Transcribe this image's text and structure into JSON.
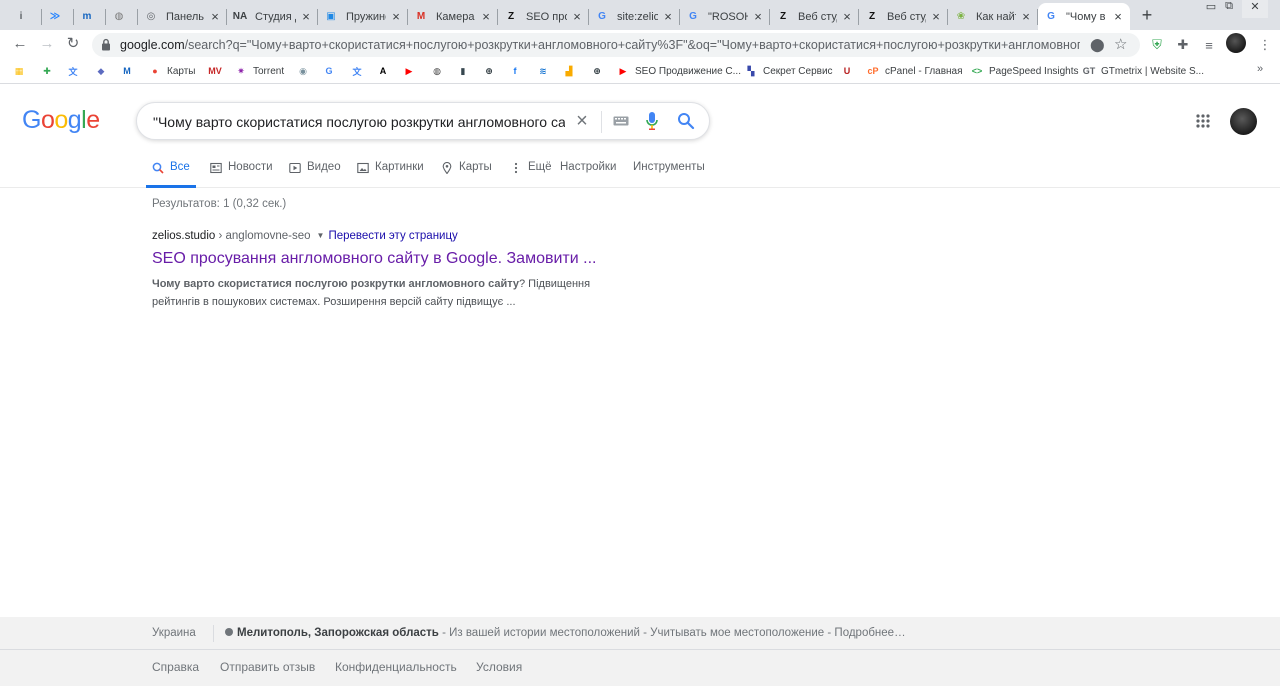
{
  "browser": {
    "tabs": [
      {
        "title": "",
        "icon": "info-icon",
        "favicon_text": "i",
        "favicon_color": "#5f6368"
      },
      {
        "title": "",
        "icon": "jira-icon",
        "favicon_text": "≫",
        "favicon_color": "#2684ff"
      },
      {
        "title": "",
        "icon": "m-icon",
        "favicon_text": "m",
        "favicon_color": "#1565c0"
      },
      {
        "title": "",
        "icon": "globe-icon",
        "favicon_text": "◍",
        "favicon_color": "#777777"
      },
      {
        "title": "Панель с",
        "icon": "globe-icon",
        "favicon_text": "◎",
        "favicon_color": "#5f6368"
      },
      {
        "title": "Студия д",
        "icon": "na-icon",
        "favicon_text": "NA",
        "favicon_color": "#3c4043"
      },
      {
        "title": "Пружине",
        "icon": "image-icon",
        "favicon_text": "▣",
        "favicon_color": "#1e88e5"
      },
      {
        "title": "Камера з",
        "icon": "gmail-icon",
        "favicon_text": "M",
        "favicon_color": "#d93025"
      },
      {
        "title": "SEO про",
        "icon": "zelios-icon",
        "favicon_text": "Z",
        "favicon_color": "#111111"
      },
      {
        "title": "site:zelio",
        "icon": "google-icon",
        "favicon_text": "G",
        "favicon_color": "#4285f4"
      },
      {
        "title": "\"ROSOH",
        "icon": "google-icon",
        "favicon_text": "G",
        "favicon_color": "#4285f4"
      },
      {
        "title": "Веб студ",
        "icon": "zelios-icon",
        "favicon_text": "Z",
        "favicon_color": "#111111"
      },
      {
        "title": "Веб студ",
        "icon": "zelios-icon",
        "favicon_text": "Z",
        "favicon_color": "#111111"
      },
      {
        "title": "Как найт",
        "icon": "leaf-icon",
        "favicon_text": "❀",
        "favicon_color": "#7cb342"
      },
      {
        "title": "\"Чому в",
        "icon": "google-icon",
        "favicon_text": "G",
        "favicon_color": "#4285f4",
        "active": true
      }
    ],
    "close_glyph": "×",
    "new_tab_glyph": "+",
    "url_host": "google.com",
    "url_rest": "/search?q=\"Чому+варто+скористатися+послугою+розкрутки+англомовного+сайту%3F\"&oq=\"Чому+варто+скористатися+послугою+розкрутки+англомовного+са...",
    "bookmarks": [
      {
        "label": "",
        "icon": "sheets-icon",
        "icon_text": "▦",
        "color": "#fbbc04"
      },
      {
        "label": "",
        "icon": "plus-icon",
        "icon_text": "✚",
        "color": "#34a853"
      },
      {
        "label": "",
        "icon": "translate-icon",
        "icon_text": "文",
        "color": "#4285f4"
      },
      {
        "label": "",
        "icon": "drop-icon",
        "icon_text": "◆",
        "color": "#5c6bc0"
      },
      {
        "label": "",
        "icon": "m-icon",
        "icon_text": "M",
        "color": "#1565c0"
      },
      {
        "label": "Карты",
        "icon": "maps-icon",
        "icon_text": "●",
        "color": "#ea4335"
      },
      {
        "label": "",
        "icon": "mv-icon",
        "icon_text": "MV",
        "color": "#c62828"
      },
      {
        "label": "Torrent",
        "icon": "torrent-icon",
        "icon_text": "✷",
        "color": "#8e24aa"
      },
      {
        "label": "",
        "icon": "dice-icon",
        "icon_text": "◉",
        "color": "#78909c"
      },
      {
        "label": "",
        "icon": "g-icon",
        "icon_text": "G",
        "color": "#4285f4"
      },
      {
        "label": "",
        "icon": "translate-icon",
        "icon_text": "文",
        "color": "#4285f4"
      },
      {
        "label": "",
        "icon": "a-icon",
        "icon_text": "A",
        "color": "#000000"
      },
      {
        "label": "",
        "icon": "youtube-icon",
        "icon_text": "▶",
        "color": "#ff0000"
      },
      {
        "label": "",
        "icon": "globe-icon",
        "icon_text": "◍",
        "color": "#444444"
      },
      {
        "label": "",
        "icon": "lock-icon",
        "icon_text": "▮",
        "color": "#37474f"
      },
      {
        "label": "",
        "icon": "www-icon",
        "icon_text": "⊕",
        "color": "#263238"
      },
      {
        "label": "",
        "icon": "facebook-icon",
        "icon_text": "f",
        "color": "#1877f2"
      },
      {
        "label": "",
        "icon": "wifi-icon",
        "icon_text": "≋",
        "color": "#1976d2"
      },
      {
        "label": "",
        "icon": "analytics-icon",
        "icon_text": "▟",
        "color": "#f9ab00"
      },
      {
        "label": "",
        "icon": "www-icon",
        "icon_text": "⊕",
        "color": "#263238"
      },
      {
        "label": "SEO Продвижение С...",
        "icon": "youtube-icon",
        "icon_text": "▶",
        "color": "#ff0000"
      },
      {
        "label": "Секрет Сервис",
        "icon": "bookmark-icon",
        "icon_text": "▚",
        "color": "#3949ab"
      },
      {
        "label": "",
        "icon": "u-icon",
        "icon_text": "U",
        "color": "#b71c1c"
      },
      {
        "label": "cPanel - Главная",
        "icon": "cpanel-icon",
        "icon_text": "cP",
        "color": "#ff6c2c"
      },
      {
        "label": "PageSpeed Insights",
        "icon": "pagespeed-icon",
        "icon_text": "<>",
        "color": "#34a853"
      },
      {
        "label": "GTmetrix | Website S...",
        "icon": "gtmetrix-icon",
        "icon_text": "GT",
        "color": "#5f6368"
      }
    ],
    "bookmarks_more": "»"
  },
  "google": {
    "logo": [
      "G",
      "o",
      "o",
      "g",
      "l",
      "e"
    ],
    "logo_colors": [
      "#4285f4",
      "#ea4335",
      "#fbbc05",
      "#4285f4",
      "#34a853",
      "#ea4335"
    ],
    "query": "\"Чому варто скористатися послугою розкрутки англомовного сайту?\"",
    "clear_glyph": "×",
    "tabs": [
      {
        "label": "Все",
        "icon": "search-icon",
        "active": true
      },
      {
        "label": "Новости",
        "icon": "news-icon"
      },
      {
        "label": "Видео",
        "icon": "video-icon"
      },
      {
        "label": "Картинки",
        "icon": "images-icon"
      },
      {
        "label": "Карты",
        "icon": "map-pin-icon"
      },
      {
        "label": "Ещё",
        "icon": "more-vert-icon"
      },
      {
        "label": "Настройки"
      },
      {
        "label": "Инструменты"
      }
    ],
    "stats": "Результатов: 1 (0,32 сек.)",
    "result": {
      "domain": "zelios.studio",
      "path": " › anglomovne-seo",
      "caret": "▼",
      "translate": "Перевести эту страницу",
      "title": "SEO просування англомовного сайту в Google. Замовити ...",
      "snippet_bold": "Чому варто скористатися послугою розкрутки англомовного сайту",
      "snippet_rest": "? Підвищення рейтингів в пошукових системах. Розширення версій сайту підвищує ..."
    },
    "footer": {
      "country": "Украина",
      "city": "Мелитополь, Запорожская область",
      "location_rest": " - Из вашей истории местоположений - Учитывать мое местоположение - Подробнее…",
      "links": [
        "Справка",
        "Отправить отзыв",
        "Конфиденциальность",
        "Условия"
      ]
    }
  }
}
